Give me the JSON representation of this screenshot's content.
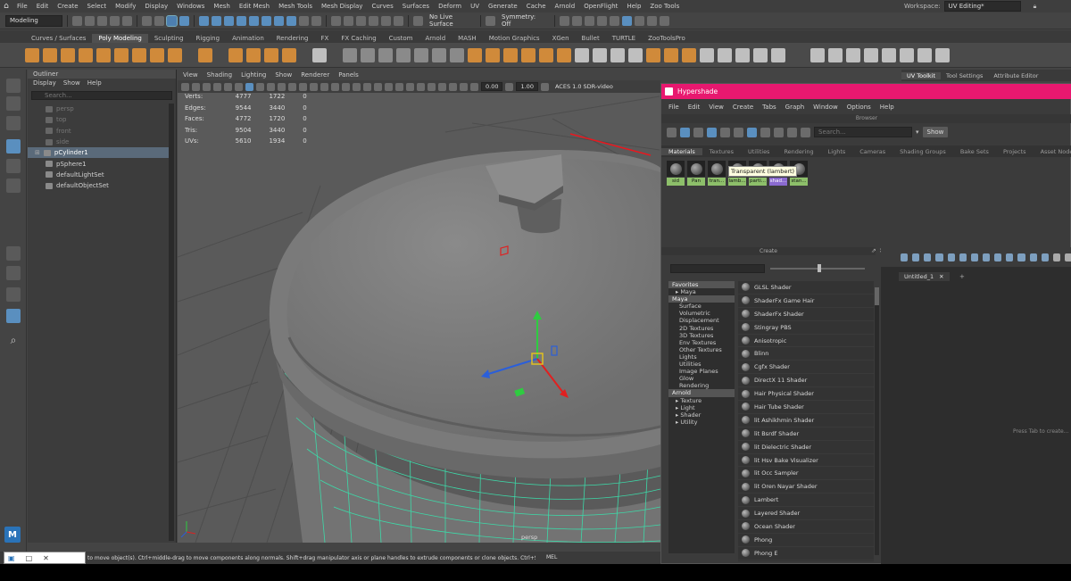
{
  "menubar": {
    "items": [
      "File",
      "Edit",
      "Create",
      "Select",
      "Modify",
      "Display",
      "Windows",
      "Mesh",
      "Edit Mesh",
      "Mesh Tools",
      "Mesh Display",
      "Curves",
      "Surfaces",
      "Deform",
      "UV",
      "Generate",
      "Cache",
      "Arnold",
      "OpenFlight",
      "Help",
      "Zoo Tools"
    ],
    "workspace_label": "Workspace:",
    "workspace_value": "UV Editing*"
  },
  "statusline": {
    "mode": "Modeling",
    "live_surface": "No Live Surface",
    "symmetry": "Symmetry: Off"
  },
  "shelf_tabs": [
    "Curves / Surfaces",
    "Poly Modeling",
    "Sculpting",
    "Rigging",
    "Animation",
    "Rendering",
    "FX",
    "FX Caching",
    "Custom",
    "Arnold",
    "MASH",
    "Motion Graphics",
    "XGen",
    "Bullet",
    "TURTLE",
    "ZooToolsPro"
  ],
  "shelf_active_tab": "Poly Modeling",
  "right_tabs": [
    "UV Toolkit",
    "Tool Settings",
    "Attribute Editor"
  ],
  "outliner": {
    "title": "Outliner",
    "menu": [
      "Display",
      "Show",
      "Help"
    ],
    "search_placeholder": "Search...",
    "items": [
      {
        "label": "persp",
        "dim": true
      },
      {
        "label": "top",
        "dim": true
      },
      {
        "label": "front",
        "dim": true
      },
      {
        "label": "side",
        "dim": true
      },
      {
        "label": "pCylinder1",
        "dim": false,
        "selected": true
      },
      {
        "label": "pSphere1",
        "dim": false
      },
      {
        "label": "defaultLightSet",
        "dim": false
      },
      {
        "label": "defaultObjectSet",
        "dim": false
      }
    ]
  },
  "viewport": {
    "menu": [
      "View",
      "Shading",
      "Lighting",
      "Show",
      "Renderer",
      "Panels"
    ],
    "exposure": "0.00",
    "gamma": "1.00",
    "color_space": "ACES 1.0 SDR-video",
    "hud": [
      {
        "k": "Verts:",
        "a": "4777",
        "b": "1722",
        "c": "0"
      },
      {
        "k": "Edges:",
        "a": "9544",
        "b": "3440",
        "c": "0"
      },
      {
        "k": "Faces:",
        "a": "4772",
        "b": "1720",
        "c": "0"
      },
      {
        "k": "Tris:",
        "a": "9504",
        "b": "3440",
        "c": "0"
      },
      {
        "k": "UVs:",
        "a": "5610",
        "b": "1934",
        "c": "0"
      }
    ],
    "camera": "persp"
  },
  "hypershade": {
    "title": "Hypershade",
    "menu": [
      "File",
      "Edit",
      "View",
      "Create",
      "Tabs",
      "Graph",
      "Window",
      "Options",
      "Help"
    ],
    "browser_label": "Browser",
    "search_placeholder": "Search...",
    "show_button": "Show",
    "tabs": [
      "Materials",
      "Textures",
      "Utilities",
      "Rendering",
      "Lights",
      "Cameras",
      "Shading Groups",
      "Bake Sets",
      "Projects",
      "Asset Nodes"
    ],
    "active_tab": "Materials",
    "swatches": [
      {
        "label": "sid",
        "purple": false
      },
      {
        "label": "Pan",
        "purple": false
      },
      {
        "label": "tran...",
        "purple": false
      },
      {
        "label": "lamb...",
        "purple": false
      },
      {
        "label": "parti...",
        "purple": false
      },
      {
        "label": "shad...",
        "purple": true
      },
      {
        "label": "stan...",
        "purple": false
      }
    ],
    "tooltip": "Transparent (lambert)",
    "create_label": "Create",
    "tree": [
      {
        "label": "Favorites",
        "kind": "cat"
      },
      {
        "label": "▸ Maya",
        "kind": "sub"
      },
      {
        "label": "Maya",
        "kind": "cat"
      },
      {
        "label": "Surface",
        "kind": "item"
      },
      {
        "label": "Volumetric",
        "kind": "item"
      },
      {
        "label": "Displacement",
        "kind": "item"
      },
      {
        "label": "2D Textures",
        "kind": "item"
      },
      {
        "label": "3D Textures",
        "kind": "item"
      },
      {
        "label": "Env Textures",
        "kind": "item"
      },
      {
        "label": "Other Textures",
        "kind": "item"
      },
      {
        "label": "Lights",
        "kind": "item"
      },
      {
        "label": "Utilities",
        "kind": "item"
      },
      {
        "label": "Image Planes",
        "kind": "item"
      },
      {
        "label": "Glow",
        "kind": "item"
      },
      {
        "label": "Rendering",
        "kind": "item"
      },
      {
        "label": "Arnold",
        "kind": "cat"
      },
      {
        "label": "▸ Texture",
        "kind": "sub"
      },
      {
        "label": "▸ Light",
        "kind": "sub"
      },
      {
        "label": "▸ Shader",
        "kind": "sub"
      },
      {
        "label": "▸ Utility",
        "kind": "sub"
      }
    ],
    "shaders": [
      "GLSL Shader",
      "ShaderFx Game Hair",
      "ShaderFx Shader",
      "Stingray PBS",
      "Anisotropic",
      "Blinn",
      "Cgfx Shader",
      "DirectX 11 Shader",
      "Hair Physical Shader",
      "Hair Tube Shader",
      "lit Ashikhmin Shader",
      "lit Bsrdf Shader",
      "lit Dielectric Shader",
      "lit Hsv Bake Visualizer",
      "lit Occ Sampler",
      "lit Oren Nayar Shader",
      "Lambert",
      "Layered Shader",
      "Ocean Shader",
      "Phong",
      "Phong E"
    ],
    "graph_tab": "Untitled_1",
    "graph_hint": "Press Tab to create..."
  },
  "commandline": {
    "help": "to move object(s). Ctrl+middle-drag to move components along normals. Shift+drag manipulator axis or plane handles to extrude components or clone objects. Ctrl+Shift+drag to c",
    "mel": "MEL"
  },
  "colors": {
    "accent": "#e8186f",
    "selection": "#5a8fbf",
    "wireframe": "#3dd9a8"
  }
}
